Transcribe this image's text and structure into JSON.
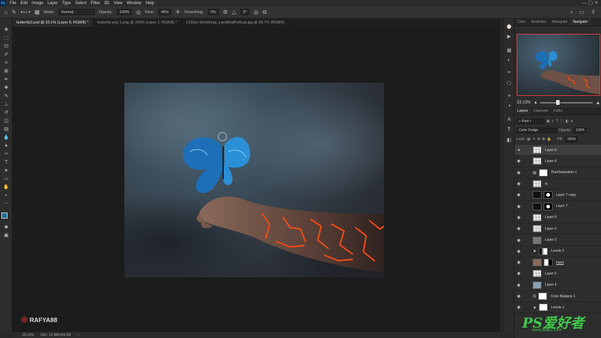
{
  "menubar": {
    "logo": "Ps",
    "items": [
      "File",
      "Edit",
      "Image",
      "Layer",
      "Type",
      "Select",
      "Filter",
      "3D",
      "View",
      "Window",
      "Help"
    ]
  },
  "options": {
    "brush_size": "500",
    "mode_label": "Mode:",
    "mode_value": "Normal",
    "opacity_label": "Opacity:",
    "opacity_value": "100%",
    "flow_label": "Flow:",
    "flow_value": "49%",
    "smoothing_label": "Smoothing:",
    "smoothing_value": "0%",
    "angle_value": "0°"
  },
  "tabs": [
    "butterfly2.psd @ 33.1% (Layer 9, RGB/8) *",
    "butterfly png 1.png @ 100% (Layer 1, RGB/8) *",
    "1920px Worldmap_LandAndPol6cat.jpg @ 66.7% (RGB/8)"
  ],
  "status": {
    "zoom": "33.13%",
    "doc": "Doc: 13.9M/184.2M"
  },
  "panel": {
    "top_tabs": [
      "Color",
      "Swatches",
      "Histogram",
      "Navigator"
    ],
    "nav_zoom": "33.13%",
    "layer_tabs": [
      "Layers",
      "Channels",
      "Paths"
    ],
    "kind_label": "Kind",
    "blend_mode": "Color Dodge",
    "opacity_label": "Opacity:",
    "opacity_value": "100%",
    "lock_label": "Lock:",
    "fill_label": "Fill:",
    "fill_value": "100%",
    "layers": [
      {
        "name": "Layer 9"
      },
      {
        "name": "Layer 8"
      },
      {
        "name": "Hue/Saturation 1"
      },
      {
        "name": "fx"
      },
      {
        "name": "Layer 7 copy"
      },
      {
        "name": "Layer 7"
      },
      {
        "name": "Layer 6"
      },
      {
        "name": "Layer 2"
      },
      {
        "name": "Layer 2"
      },
      {
        "name": "Levels 2"
      },
      {
        "name": "hand"
      },
      {
        "name": "Layer 5"
      },
      {
        "name": "Layer 4"
      },
      {
        "name": "Color Balance 1"
      },
      {
        "name": "Levels 1"
      }
    ]
  },
  "watermark": {
    "author": "RAFYA88",
    "site_logo": "PS爱好者",
    "site_url": "www.psahz.com"
  }
}
